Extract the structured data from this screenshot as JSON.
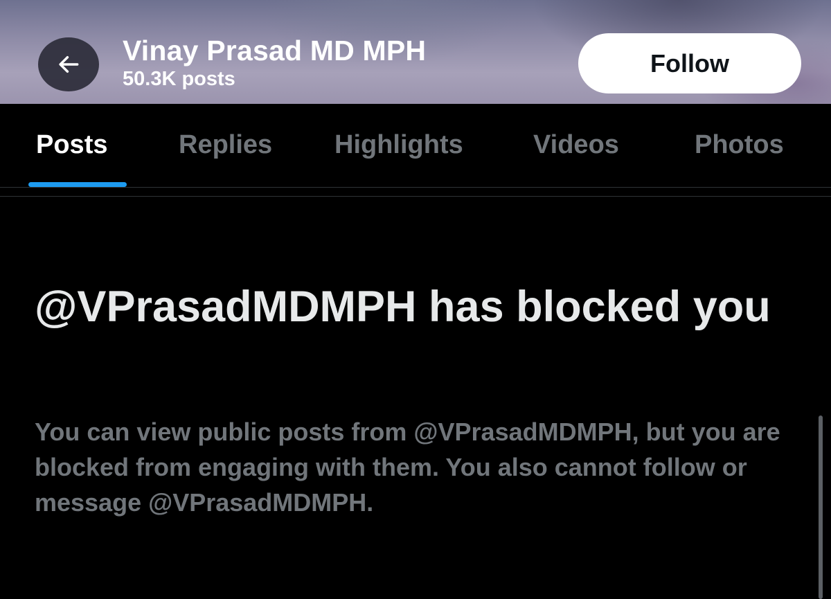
{
  "header": {
    "back_icon": "arrow-left-icon",
    "profile_name": "Vinay Prasad MD MPH",
    "post_count": "50.3K posts",
    "follow_label": "Follow"
  },
  "tabs": [
    {
      "label": "Posts",
      "active": true
    },
    {
      "label": "Replies",
      "active": false
    },
    {
      "label": "Highlights",
      "active": false
    },
    {
      "label": "Videos",
      "active": false
    },
    {
      "label": "Photos",
      "active": false
    }
  ],
  "blocked": {
    "title": "@VPrasadMDMPH has blocked you",
    "description": "You can view public posts from @VPrasadMDMPH, but you are blocked from engaging with them. You also cannot follow or message @VPrasadMDMPH."
  },
  "colors": {
    "background": "#000000",
    "accent": "#1d9bf0",
    "muted_text": "#71767b",
    "primary_text": "#e7e9ea"
  }
}
